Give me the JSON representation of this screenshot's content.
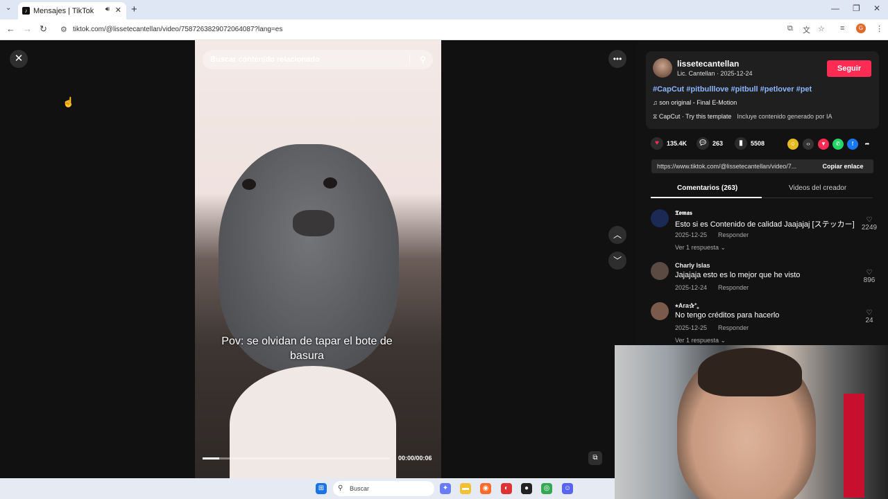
{
  "browser": {
    "tab_title": "Mensajes | TikTok",
    "url": "tiktok.com/@lissetecantellan/video/7587263829072064087?lang=es"
  },
  "video": {
    "search_placeholder": "Buscar contenido relacionado",
    "caption": "Pov: se olvidan de tapar el bote de basura",
    "time": "00:00/00:06",
    "progress": 0.09
  },
  "creator": {
    "username": "lissetecantellan",
    "subtitle": "Lic. Cantellan · 2025-12-24",
    "follow_label": "Seguir",
    "hashtags": "#CapCut #pitbulllove #pitbull #petlover #pet",
    "music": "son original - Final E-Motion",
    "capcut": "CapCut · Try this template",
    "ai_notice": "Incluye contenido generado por IA"
  },
  "stats": {
    "likes": "135.4K",
    "comments": "263",
    "saves": "5508"
  },
  "link": {
    "url": "https://www.tiktok.com/@lissetecantellan/video/7...",
    "copy_label": "Copiar enlace"
  },
  "tabs": {
    "comments": "Comentarios (263)",
    "creator_videos": "Videos del creador"
  },
  "comments": [
    {
      "name": "𝕿𝖔𝖒𝖆𝖘",
      "text": "Esto si es Contenido de calidad Jaajajaj [ステッカー]",
      "date": "2025-12-25",
      "reply": "Responder",
      "likes": "2249",
      "replies": "Ver 1 respuesta ⌄"
    },
    {
      "name": "Charly Islas",
      "text": "Jajajaja esto es lo mejor que he visto",
      "date": "2025-12-24",
      "reply": "Responder",
      "likes": "896",
      "replies": ""
    },
    {
      "name": "⭑Ara✰⁺₊",
      "text": "No tengo créditos para hacerlo",
      "date": "2025-12-25",
      "reply": "Responder",
      "likes": "24",
      "replies": "Ver 1 respuesta ⌄"
    }
  ],
  "taskbar": {
    "search": "Buscar"
  }
}
